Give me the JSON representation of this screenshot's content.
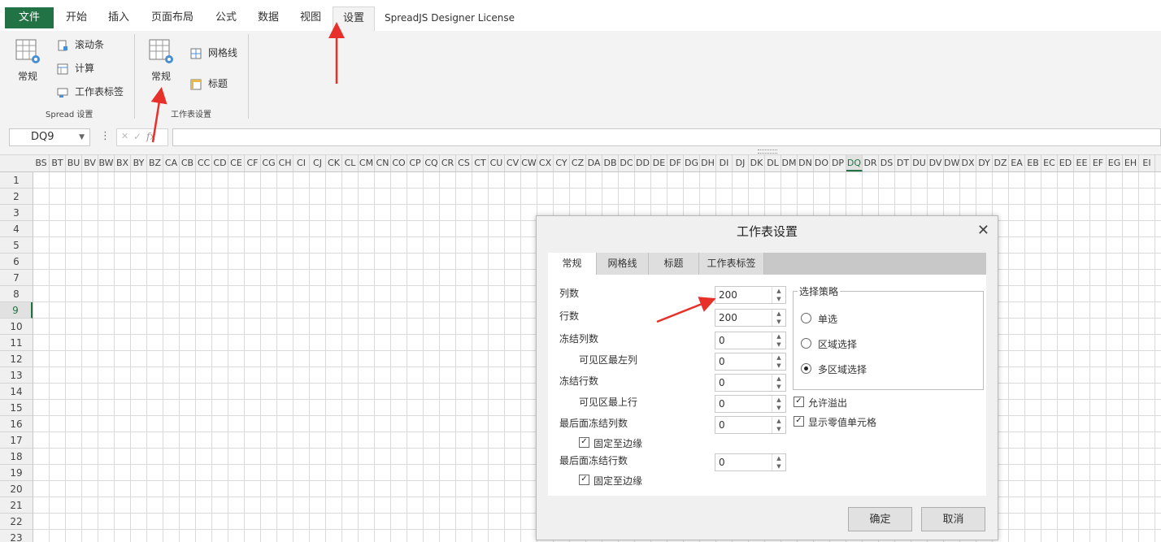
{
  "ribbon_tabs": {
    "file": "文件",
    "home": "开始",
    "insert": "插入",
    "page_layout": "页面布局",
    "formulas": "公式",
    "data": "数据",
    "view": "视图",
    "settings": "设置",
    "license": "SpreadJS Designer License"
  },
  "ribbon": {
    "spread_group": {
      "label": "Spread 设置",
      "general": "常规",
      "scrollbars": "滚动条",
      "calculation": "计算",
      "sheet_tabs": "工作表标签"
    },
    "sheet_group": {
      "label": "工作表设置",
      "general": "常规",
      "gridlines": "网格线",
      "headers": "标题"
    }
  },
  "formula_bar": {
    "name_box": "DQ9",
    "cancel": "✕",
    "confirm": "✓",
    "fx": "fx",
    "formula": ""
  },
  "sheet": {
    "columns": [
      "BS",
      "BT",
      "BU",
      "BV",
      "BW",
      "BX",
      "BY",
      "BZ",
      "CA",
      "CB",
      "CC",
      "CD",
      "CE",
      "CF",
      "CG",
      "CH",
      "CI",
      "CJ",
      "CK",
      "CL",
      "CM",
      "CN",
      "CO",
      "CP",
      "CQ",
      "CR",
      "CS",
      "CT",
      "CU",
      "CV",
      "CW",
      "CX",
      "CY",
      "CZ",
      "DA",
      "DB",
      "DC",
      "DD",
      "DE",
      "DF",
      "DG",
      "DH",
      "DI",
      "DJ",
      "DK",
      "DL",
      "DM",
      "DN",
      "DO",
      "DP",
      "DQ",
      "DR",
      "DS",
      "DT",
      "DU",
      "DV",
      "DW",
      "DX",
      "DY",
      "DZ",
      "EA",
      "EB",
      "EC",
      "ED",
      "EE",
      "EF",
      "EG",
      "EH",
      "EI"
    ],
    "selected_column": "DQ",
    "rows": [
      "1",
      "2",
      "3",
      "4",
      "5",
      "6",
      "7",
      "8",
      "9",
      "10",
      "11",
      "12",
      "13",
      "14",
      "15",
      "16",
      "17",
      "18",
      "19",
      "20",
      "21",
      "22",
      "23"
    ],
    "selected_row": "9"
  },
  "dialog": {
    "title": "工作表设置",
    "close": "✕",
    "tabs": [
      "常规",
      "网格线",
      "标题",
      "工作表标签"
    ],
    "active_tab": "常规",
    "fields": {
      "column_count": {
        "label": "列数",
        "value": "200"
      },
      "row_count": {
        "label": "行数",
        "value": "200"
      },
      "frozen_columns": {
        "label": "冻结列数",
        "value": "0"
      },
      "leftmost_visible_column": {
        "label": "可见区最左列",
        "value": "0"
      },
      "frozen_rows": {
        "label": "冻结行数",
        "value": "0"
      },
      "topmost_visible_row": {
        "label": "可见区最上行",
        "value": "0"
      },
      "trailing_frozen_columns": {
        "label": "最后面冻结列数",
        "value": "0"
      },
      "pin_column_to_edge": {
        "label": "固定至边缘",
        "checked": true
      },
      "trailing_frozen_rows": {
        "label": "最后面冻结行数",
        "value": "0"
      },
      "pin_row_to_edge": {
        "label": "固定至边缘",
        "checked": true
      }
    },
    "selection_policy": {
      "legend": "选择策略",
      "options": [
        "单选",
        "区域选择",
        "多区域选择"
      ],
      "selected": "多区域选择"
    },
    "allow_overflow": {
      "label": "允许溢出",
      "checked": true
    },
    "show_zero_cells": {
      "label": "显示零值单元格",
      "checked": true
    },
    "ok": "确定",
    "cancel": "取消"
  },
  "colors": {
    "accent_green": "#217346",
    "annotation_arrow": "#e8302a"
  }
}
